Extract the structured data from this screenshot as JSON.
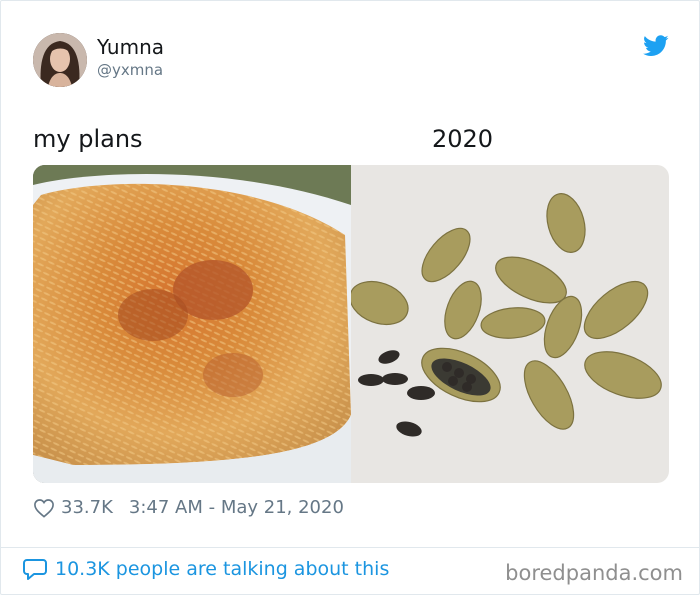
{
  "tweet": {
    "user_name": "Yumna",
    "user_handle": "@yxmna",
    "caption_left": "my plans",
    "caption_right": "2020",
    "likes": "33.7K",
    "timestamp": "3:47 AM - May 21, 2020",
    "talking": "10.3K people are talking about this"
  },
  "footer": {
    "brand": "boredpanda.com"
  },
  "icons": {
    "twitter": "twitter-bird-icon",
    "like": "heart-icon",
    "reply": "speech-bubble-icon"
  },
  "colors": {
    "twitter_blue": "#1da1f2",
    "link_blue": "#1b95e0",
    "muted": "#657786"
  }
}
